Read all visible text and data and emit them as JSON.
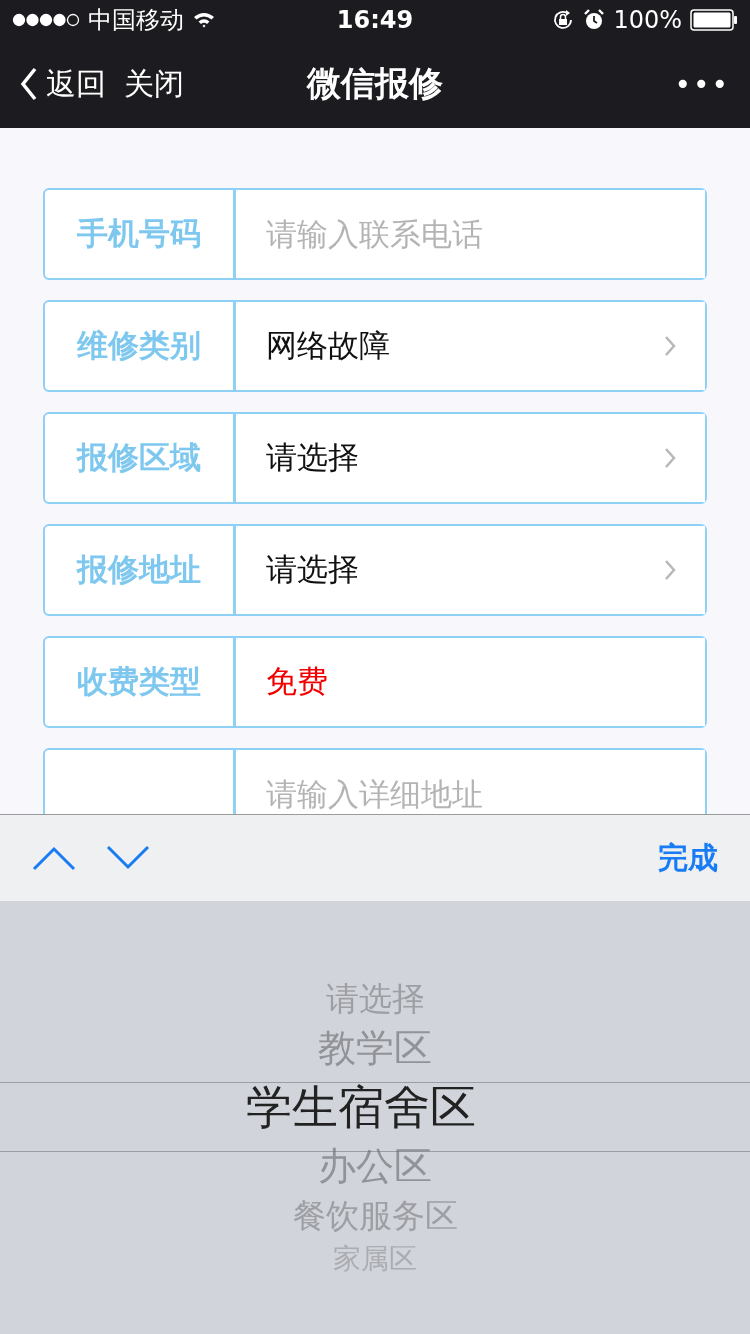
{
  "status_bar": {
    "carrier": "中国移动",
    "time": "16:49",
    "battery": "100%"
  },
  "nav": {
    "back": "返回",
    "close": "关闭",
    "title": "微信报修",
    "more": "•••"
  },
  "form": [
    {
      "kind": "input",
      "label": "手机号码",
      "placeholder": "请输入联系电话"
    },
    {
      "kind": "select",
      "label": "维修类别",
      "value": "网络故障"
    },
    {
      "kind": "select",
      "label": "报修区域",
      "value": "请选择"
    },
    {
      "kind": "select",
      "label": "报修地址",
      "value": "请选择"
    },
    {
      "kind": "static",
      "label": "收费类型",
      "value": "免费"
    },
    {
      "kind": "input",
      "placeholder": "请输入详细地址"
    }
  ],
  "toolbar": {
    "done": "完成"
  },
  "picker": [
    {
      "label": "请选择",
      "selected": false
    },
    {
      "label": "教学区",
      "selected": false
    },
    {
      "label": "学生宿舍区",
      "selected": true
    },
    {
      "label": "办公区",
      "selected": false
    },
    {
      "label": "餐饮服务区",
      "selected": false
    },
    {
      "label": "家属区",
      "selected": false
    }
  ]
}
